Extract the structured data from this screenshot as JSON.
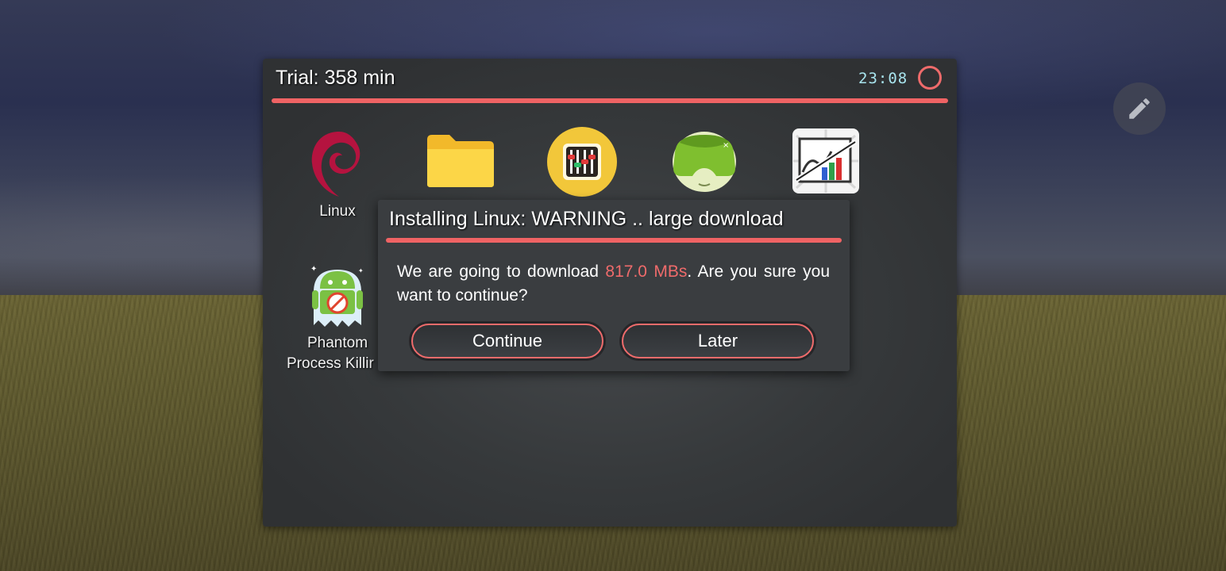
{
  "panel": {
    "title": "Trial: 358 min",
    "clock": "23:08",
    "record_icon": "record-circle-icon"
  },
  "apps": [
    {
      "label": "Linux",
      "icon": "debian-swirl-icon"
    },
    {
      "label": "",
      "icon": "folder-icon"
    },
    {
      "label": "",
      "icon": "mixer-sliders-icon"
    },
    {
      "label": "",
      "icon": "vr-headset-icon"
    },
    {
      "label": "",
      "icon": "chart-disabled-icon"
    },
    {
      "label_line1": "Phantom",
      "label_line2": "Process Killir",
      "icon": "android-ghost-icon"
    }
  ],
  "dialog": {
    "title": "Installing Linux: WARNING .. large download",
    "message_before": "We are going to download ",
    "message_size": "817.0 MBs",
    "message_after": ". Are you sure you want to continue?",
    "continue_label": "Continue",
    "later_label": "Later"
  },
  "floating": {
    "edit_icon": "pencil-icon"
  },
  "colors": {
    "accent": "#ef6364",
    "clock": "#a8e4ee",
    "panel_bg": "#36393b"
  }
}
